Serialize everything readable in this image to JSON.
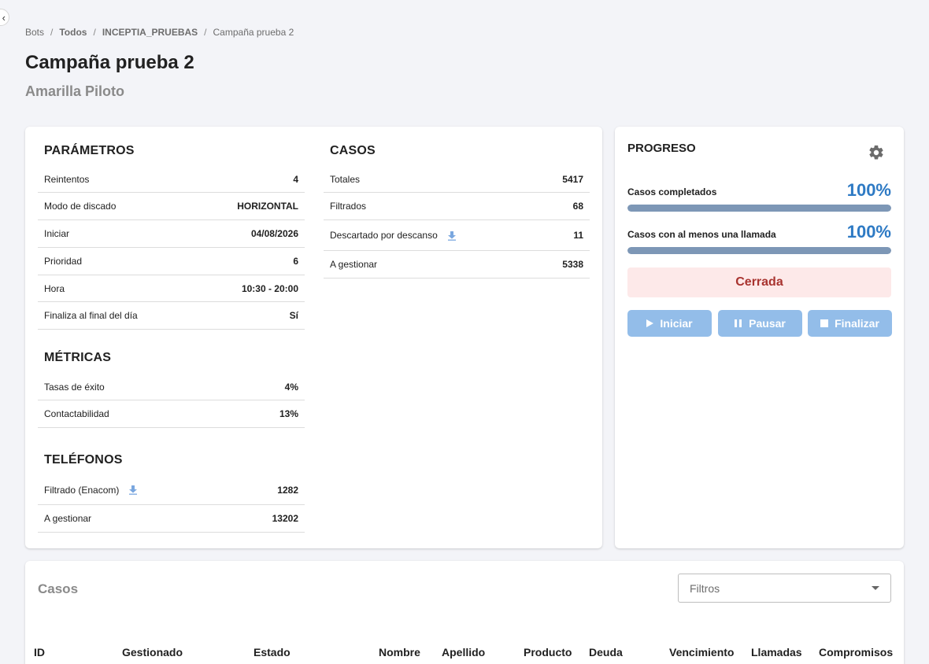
{
  "breadcrumb": [
    {
      "label": "Bots",
      "bold": false
    },
    {
      "label": "Todos",
      "bold": true
    },
    {
      "label": "INCEPTIA_PRUEBAS",
      "bold": true
    },
    {
      "label": "Campaña prueba 2",
      "bold": false
    }
  ],
  "page": {
    "title": "Campaña prueba 2",
    "subtitle": "Amarilla Piloto"
  },
  "parametros": {
    "title": "PARÁMETROS",
    "rows": [
      {
        "label": "Reintentos",
        "value": "4"
      },
      {
        "label": "Modo de discado",
        "value": "HORIZONTAL"
      },
      {
        "label": "Iniciar",
        "value": "04/08/2026"
      },
      {
        "label": "Prioridad",
        "value": "6"
      },
      {
        "label": "Hora",
        "value": "10:30 - 20:00"
      },
      {
        "label": "Finaliza al final del día",
        "value": "Sí"
      }
    ]
  },
  "metricas": {
    "title": "MÉTRICAS",
    "rows": [
      {
        "label": "Tasas de éxito",
        "value": "4%"
      },
      {
        "label": "Contactabilidad",
        "value": "13%"
      }
    ]
  },
  "telefonos": {
    "title": "TELÉFONOS",
    "rows": [
      {
        "label": "Filtrado (Enacom)",
        "value": "1282"
      },
      {
        "label": "A gestionar",
        "value": "13202"
      }
    ]
  },
  "casos": {
    "title": "CASOS",
    "rows": [
      {
        "label": "Totales",
        "value": "5417"
      },
      {
        "label": "Filtrados",
        "value": "68"
      },
      {
        "label": "Descartado por descanso",
        "value": "11"
      },
      {
        "label": "A gestionar",
        "value": "5338"
      }
    ]
  },
  "progreso": {
    "title": "PROGRESO",
    "items": [
      {
        "label": "Casos completados",
        "percent_text": "100%",
        "fraction": 1.0
      },
      {
        "label": "Casos con al menos una llamada",
        "percent_text": "100%",
        "fraction": 1.0
      }
    ],
    "status": "Cerrada",
    "buttons": {
      "start": "Iniciar",
      "pause": "Pausar",
      "finish": "Finalizar"
    }
  },
  "cases_table": {
    "title": "Casos",
    "filter_placeholder": "Filtros",
    "columns": [
      "ID",
      "Gestionado",
      "Estado",
      "Nombre",
      "Apellido",
      "Producto",
      "Deuda",
      "Vencimiento",
      "Llamadas",
      "Compromisos"
    ]
  },
  "colors": {
    "accent": "#2e7ac4",
    "progress_fill": "#7d97b6",
    "status_bg": "#fde9e9",
    "status_text": "#a8332f",
    "button_bg": "#93bde9"
  },
  "icons": {
    "download": "download-icon",
    "settings": "gear-icon",
    "play": "play-icon",
    "pause": "pause-icon",
    "stop": "stop-icon",
    "dropdown": "chevron-down-icon"
  }
}
